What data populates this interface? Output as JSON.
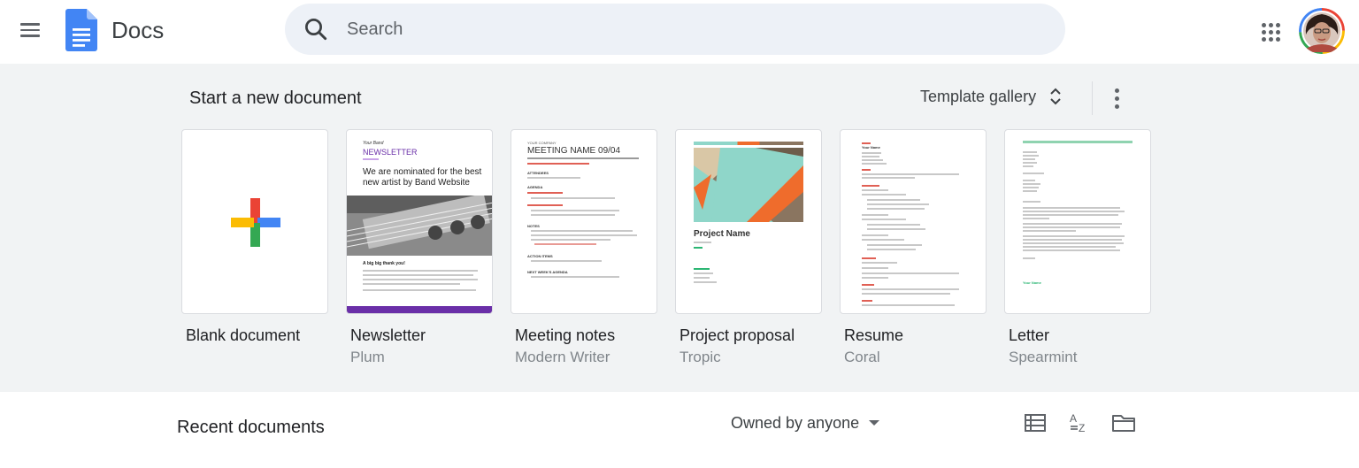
{
  "header": {
    "app_name": "Docs",
    "search_placeholder": "Search"
  },
  "templates": {
    "section_title": "Start a new document",
    "gallery_label": "Template gallery",
    "cards": [
      {
        "title": "Blank document",
        "subtitle": ""
      },
      {
        "title": "Newsletter",
        "subtitle": "Plum"
      },
      {
        "title": "Meeting notes",
        "subtitle": "Modern Writer"
      },
      {
        "title": "Project proposal",
        "subtitle": "Tropic"
      },
      {
        "title": "Resume",
        "subtitle": "Coral"
      },
      {
        "title": "Letter",
        "subtitle": "Spearmint"
      }
    ],
    "thumbs": {
      "newsletter": {
        "brand": "Your Band",
        "heading": "NEWSLETTER",
        "headline": "We are nominated for the best new artist by Band Website",
        "caption": "A big big thank you!"
      },
      "meeting": {
        "company": "YOUR COMPANY",
        "heading": "MEETING NAME 09/04",
        "sections": [
          "ATTENDEES",
          "AGENDA",
          "NOTES",
          "ACTION ITEMS",
          "NEXT WEEK'S AGENDA"
        ]
      },
      "proposal": {
        "heading": "Project Name"
      },
      "resume": {
        "name": "Your Name"
      },
      "letter": {
        "closing": "Your Name"
      }
    }
  },
  "recent": {
    "title": "Recent documents",
    "owner_filter": "Owned by anyone"
  },
  "colors": {
    "docs_blue": "#4285f4",
    "plum": "#6a2fa8",
    "coral": "#e06055",
    "spearmint": "#2bb673",
    "tropic_teal": "#8fd6c9",
    "tropic_orange": "#ef6c2c"
  }
}
